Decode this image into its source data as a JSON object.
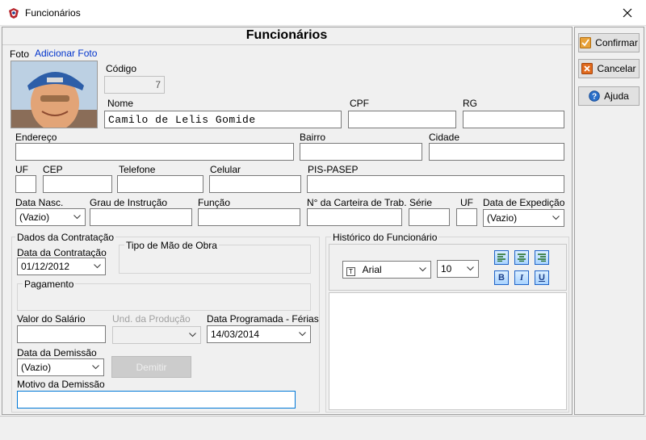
{
  "window": {
    "title": "Funcionários"
  },
  "form": {
    "title": "Funcionários"
  },
  "photo": {
    "label": "Foto",
    "add_link": "Adicionar Foto"
  },
  "fields": {
    "codigo": {
      "label": "Código",
      "value": "7"
    },
    "nome": {
      "label": "Nome",
      "value": "Camilo de Lelis Gomide"
    },
    "cpf": {
      "label": "CPF",
      "value": ""
    },
    "rg": {
      "label": "RG",
      "value": ""
    },
    "endereco": {
      "label": "Endereço",
      "value": ""
    },
    "bairro": {
      "label": "Bairro",
      "value": ""
    },
    "cidade": {
      "label": "Cidade",
      "value": ""
    },
    "uf": {
      "label": "UF",
      "value": ""
    },
    "cep": {
      "label": "CEP",
      "value": ""
    },
    "telefone": {
      "label": "Telefone",
      "value": ""
    },
    "celular": {
      "label": "Celular",
      "value": ""
    },
    "pis": {
      "label": "PIS-PASEP",
      "value": ""
    },
    "data_nasc": {
      "label": "Data Nasc.",
      "value": "(Vazio)"
    },
    "grau": {
      "label": "Grau de Instrução",
      "value": ""
    },
    "funcao": {
      "label": "Função",
      "value": ""
    },
    "carteira": {
      "label": "N° da Carteira de Trab.",
      "value": ""
    },
    "serie": {
      "label": "Série",
      "value": ""
    },
    "uf_carteira": {
      "label": "UF",
      "value": ""
    },
    "data_exp": {
      "label": "Data de Expedição",
      "value": "(Vazio)"
    }
  },
  "contratacao": {
    "caption": "Dados da Contratação",
    "data_label": "Data da Contratação",
    "data_value": "01/12/2012",
    "tipo_caption": "Tipo de Mão de Obra",
    "pagamento_caption": "Pagamento",
    "salario_label": "Valor do Salário",
    "salario_value": "",
    "und_label": "Und. da Produção",
    "und_value": "",
    "ferias_label": "Data Programada - Férias",
    "ferias_value": "14/03/2014",
    "demissao_label": "Data da Demissão",
    "demissao_value": "(Vazio)",
    "demitir_label": "Demitir",
    "motivo_label": "Motivo da Demissão",
    "motivo_value": ""
  },
  "historico": {
    "caption": "Histórico do Funcionário",
    "font": "Arial",
    "size": "10",
    "text": ""
  },
  "actions": {
    "confirmar": "Confirmar",
    "cancelar": "Cancelar",
    "ajuda": "Ajuda"
  },
  "colors": {
    "focus": "#0078d7",
    "link": "#0033cc",
    "confirm_icon": "#e8a23a",
    "cancel_icon": "#e06a1d",
    "help_icon": "#2a6fc9"
  }
}
